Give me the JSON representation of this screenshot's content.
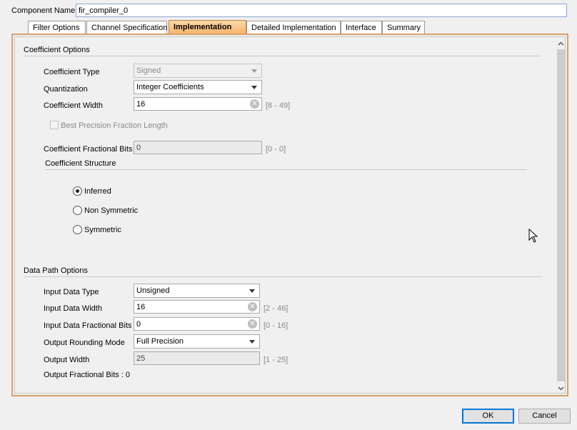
{
  "header": {
    "component_name_label": "Component Name",
    "component_name_value": "fir_compiler_0"
  },
  "tabs": [
    {
      "label": "Filter Options"
    },
    {
      "label": "Channel Specification"
    },
    {
      "label": "Implementation",
      "active": true
    },
    {
      "label": "Detailed Implementation"
    },
    {
      "label": "Interface"
    },
    {
      "label": "Summary"
    }
  ],
  "coefficient_options": {
    "title": "Coefficient Options",
    "coefficient_type_label": "Coefficient Type",
    "coefficient_type_value": "Signed",
    "quantization_label": "Quantization",
    "quantization_value": "Integer Coefficients",
    "coefficient_width_label": "Coefficient Width",
    "coefficient_width_value": "16",
    "coefficient_width_range": "[8 - 49]",
    "best_precision_label": "Best Precision Fraction Length",
    "fractional_bits_label": "Coefficient Fractional Bits",
    "fractional_bits_value": "0",
    "fractional_bits_range": "[0 - 0]",
    "structure_title": "Coefficient Structure",
    "structure_options": [
      "Inferred",
      "Non Symmetric",
      "Symmetric"
    ]
  },
  "data_path_options": {
    "title": "Data Path Options",
    "input_data_type_label": "Input Data Type",
    "input_data_type_value": "Unsigned",
    "input_data_width_label": "Input Data Width",
    "input_data_width_value": "16",
    "input_data_width_range": "[2 - 46]",
    "input_fractional_bits_label": "Input Data Fractional Bits",
    "input_fractional_bits_value": "0",
    "input_fractional_bits_range": "[0 - 16]",
    "output_rounding_label": "Output Rounding Mode",
    "output_rounding_value": "Full Precision",
    "output_width_label": "Output Width",
    "output_width_value": "25",
    "output_width_range": "[1 - 25]",
    "output_fractional_bits_text": "Output Fractional Bits : 0"
  },
  "buttons": {
    "ok": "OK",
    "cancel": "Cancel"
  },
  "colors": {
    "active_tab": "#f6b46a",
    "panel_border": "#d9a06a",
    "default_button_border": "#0078d7"
  }
}
